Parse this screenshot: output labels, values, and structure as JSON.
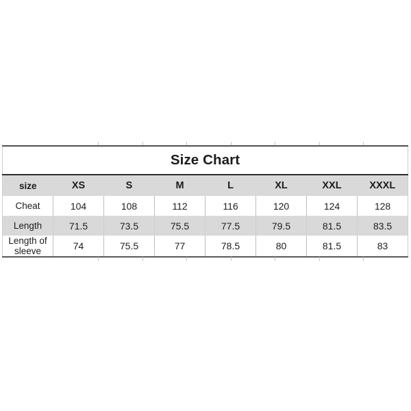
{
  "chart_data": {
    "type": "table",
    "title": "Size Chart",
    "corner_label": "size",
    "categories": [
      "XS",
      "S",
      "M",
      "L",
      "XL",
      "XXL",
      "XXXL"
    ],
    "row_labels": [
      "Cheat",
      "Length",
      "Length of sleeve"
    ],
    "series": [
      {
        "name": "Cheat",
        "values": [
          104,
          108,
          112,
          116,
          120,
          124,
          128
        ]
      },
      {
        "name": "Length",
        "values": [
          71.5,
          73.5,
          75.5,
          77.5,
          79.5,
          81.5,
          83.5
        ]
      },
      {
        "name": "Length of sleeve",
        "values": [
          74,
          75.5,
          77,
          78.5,
          80,
          81.5,
          83
        ]
      }
    ],
    "xlabel": "",
    "ylabel": "",
    "grid": true,
    "legend": "none"
  },
  "table": {
    "title": "Size Chart",
    "header": {
      "label": "size",
      "columns": [
        "XS",
        "S",
        "M",
        "L",
        "XL",
        "XXL",
        "XXXL"
      ]
    },
    "rows": [
      {
        "label": "Cheat",
        "cells": [
          "104",
          "108",
          "112",
          "116",
          "120",
          "124",
          "128"
        ]
      },
      {
        "label": "Length",
        "cells": [
          "71.5",
          "73.5",
          "75.5",
          "77.5",
          "79.5",
          "81.5",
          "83.5"
        ]
      },
      {
        "label": "Length of sleeve",
        "cells": [
          "74",
          "75.5",
          "77",
          "78.5",
          "80",
          "81.5",
          "83"
        ]
      }
    ]
  },
  "colors": {
    "page_background": "#ffffff",
    "header_band": "#d9d9d9",
    "zebra_band": "#d9d9d9",
    "cell_background": "#ffffff",
    "text": "#1c1c1c",
    "heavy_rule": "#2b2b2b",
    "light_rule": "#b9bdc9"
  }
}
